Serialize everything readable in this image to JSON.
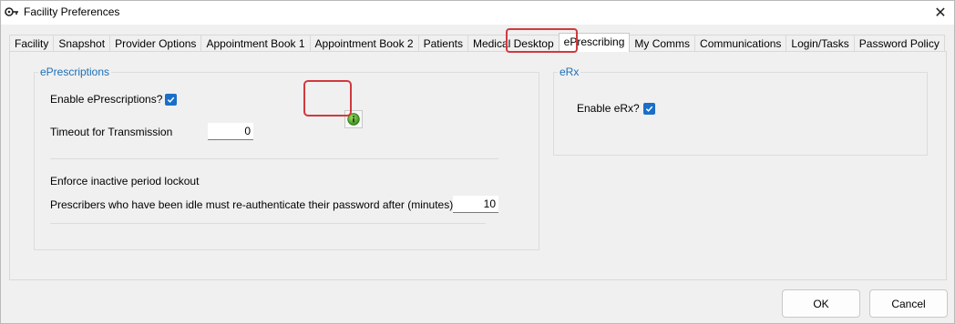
{
  "window": {
    "title": "Facility Preferences"
  },
  "tabs": [
    {
      "label": "Facility"
    },
    {
      "label": "Snapshot"
    },
    {
      "label": "Provider Options"
    },
    {
      "label": "Appointment Book 1"
    },
    {
      "label": "Appointment Book 2"
    },
    {
      "label": "Patients"
    },
    {
      "label": "Medical Desktop"
    },
    {
      "label": "ePrescribing",
      "active": true
    },
    {
      "label": "My Comms"
    },
    {
      "label": "Communications"
    },
    {
      "label": "Login/Tasks"
    },
    {
      "label": "Password Policy"
    }
  ],
  "eprescriptions": {
    "group_title": "ePrescriptions",
    "enable_label": "Enable ePrescriptions?",
    "enable_checked": true,
    "timeout_label": "Timeout for Transmission",
    "timeout_value": "0",
    "enforce_label": "Enforce inactive period lockout",
    "idle_label": "Prescribers who have been idle must re-authenticate their password after (minutes)",
    "idle_value": "10"
  },
  "erx": {
    "group_title": "eRx",
    "enable_label": "Enable eRx?",
    "enable_checked": true
  },
  "buttons": {
    "ok": "OK",
    "cancel": "Cancel"
  },
  "colors": {
    "accent": "#1a6fc7",
    "highlight": "#d03a3e",
    "group_title": "#1c6fb8"
  }
}
